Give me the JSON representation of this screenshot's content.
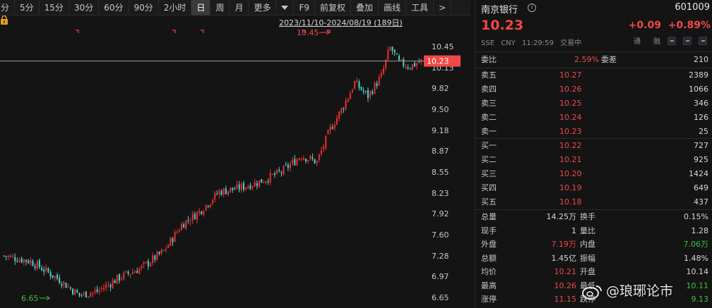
{
  "toolbar": {
    "items": [
      "分",
      "5分",
      "15分",
      "30分",
      "60分",
      "90分",
      "2小时",
      "日",
      "周",
      "月",
      "更多",
      "",
      "F9",
      "前复权",
      "叠加",
      "画线",
      "工具",
      ">"
    ],
    "active_index": 7
  },
  "chart": {
    "range_label": "2023/11/10-2024/08/19 (189日)",
    "current_price_tag": "10.23",
    "high_marker": "10.45",
    "low_marker": "6.65",
    "y_ticks": [
      "10.45",
      "10.13",
      "9.82",
      "9.50",
      "9.18",
      "8.87",
      "8.55",
      "8.23",
      "7.92",
      "7.60",
      "7.28",
      "6.97",
      "6.65"
    ],
    "colors": {
      "up": "#e83030",
      "down": "#4dd0d0",
      "price_line": "#9a9a9a",
      "tag_bg": "#f04848"
    }
  },
  "chart_data": {
    "type": "candlestick",
    "ylim": [
      6.65,
      10.45
    ],
    "start_price": 7.28,
    "low": 6.65,
    "high": 10.45,
    "last": 10.23,
    "count": 189
  },
  "panel": {
    "name": "南京银行",
    "code": "601009",
    "price": "10.23",
    "change": "+0.09",
    "change_pct": "+0.89%",
    "sub": {
      "exchange": "SSE",
      "currency": "CNY",
      "time": "11:29:59",
      "status": "交易中",
      "btn1": "通",
      "btn2": "融"
    },
    "weibi": {
      "label": "委比",
      "value": "2.59%",
      "label2": "委差",
      "value2": "210"
    },
    "asks": [
      {
        "label": "卖五",
        "price": "10.27",
        "vol": "2389"
      },
      {
        "label": "卖四",
        "price": "10.26",
        "vol": "1066"
      },
      {
        "label": "卖三",
        "price": "10.25",
        "vol": "346"
      },
      {
        "label": "卖二",
        "price": "10.24",
        "vol": "126"
      },
      {
        "label": "卖一",
        "price": "10.23",
        "vol": "25"
      }
    ],
    "bids": [
      {
        "label": "买一",
        "price": "10.22",
        "vol": "727"
      },
      {
        "label": "买二",
        "price": "10.21",
        "vol": "925"
      },
      {
        "label": "买三",
        "price": "10.20",
        "vol": "1424"
      },
      {
        "label": "买四",
        "price": "10.19",
        "vol": "649"
      },
      {
        "label": "买五",
        "price": "10.18",
        "vol": "437"
      }
    ],
    "stats": [
      {
        "l1": "总量",
        "v1": "14.25万",
        "c1": "white",
        "l2": "换手",
        "v2": "0.15%",
        "c2": "white"
      },
      {
        "l1": "现手",
        "v1": "1",
        "c1": "white",
        "l2": "量比",
        "v2": "1.28",
        "c2": "white"
      },
      {
        "l1": "外盘",
        "v1": "7.19万",
        "c1": "red",
        "l2": "内盘",
        "v2": "7.06万",
        "c2": "green"
      },
      {
        "l1": "总额",
        "v1": "1.45亿",
        "c1": "white",
        "l2": "振幅",
        "v2": "1.48%",
        "c2": "white"
      },
      {
        "l1": "均价",
        "v1": "10.21",
        "c1": "red",
        "l2": "开盘",
        "v2": "10.14",
        "c2": "white"
      },
      {
        "l1": "最高",
        "v1": "10.26",
        "c1": "red",
        "l2": "最低",
        "v2": "10.11",
        "c2": "green"
      },
      {
        "l1": "涨停",
        "v1": "11.15",
        "c1": "red",
        "l2": "跌停",
        "v2": "9.13",
        "c2": "green"
      }
    ]
  },
  "watermark": "@琅琊论市"
}
